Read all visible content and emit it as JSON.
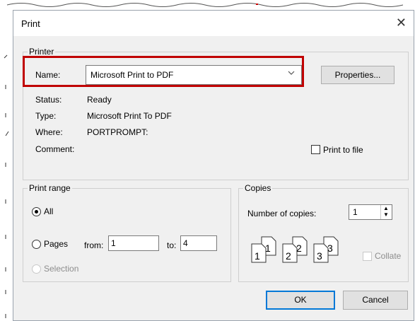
{
  "dialog": {
    "title": "Print",
    "close_glyph": "✕"
  },
  "printer": {
    "group_label": "Printer",
    "name_label": "Name:",
    "name_value": "Microsoft Print to PDF",
    "properties_label": "Properties...",
    "status_label": "Status:",
    "status_value": "Ready",
    "type_label": "Type:",
    "type_value": "Microsoft Print To PDF",
    "where_label": "Where:",
    "where_value": "PORTPROMPT:",
    "comment_label": "Comment:",
    "print_to_file_label": "Print to file",
    "print_to_file_checked": false
  },
  "print_range": {
    "group_label": "Print range",
    "all_label": "All",
    "pages_label": "Pages",
    "from_label": "from:",
    "from_value": "1",
    "to_label": "to:",
    "to_value": "4",
    "selection_label": "Selection",
    "selected": "All"
  },
  "copies": {
    "group_label": "Copies",
    "number_label": "Number of copies:",
    "number_value": "1",
    "collate_label": "Collate",
    "collate_checked": false,
    "collate_enabled": false,
    "icon_numbers": [
      "1",
      "1",
      "2",
      "2",
      "3",
      "3"
    ]
  },
  "buttons": {
    "ok": "OK",
    "cancel": "Cancel"
  },
  "colors": {
    "highlight": "#c00000",
    "default_button_border": "#0078d7"
  }
}
